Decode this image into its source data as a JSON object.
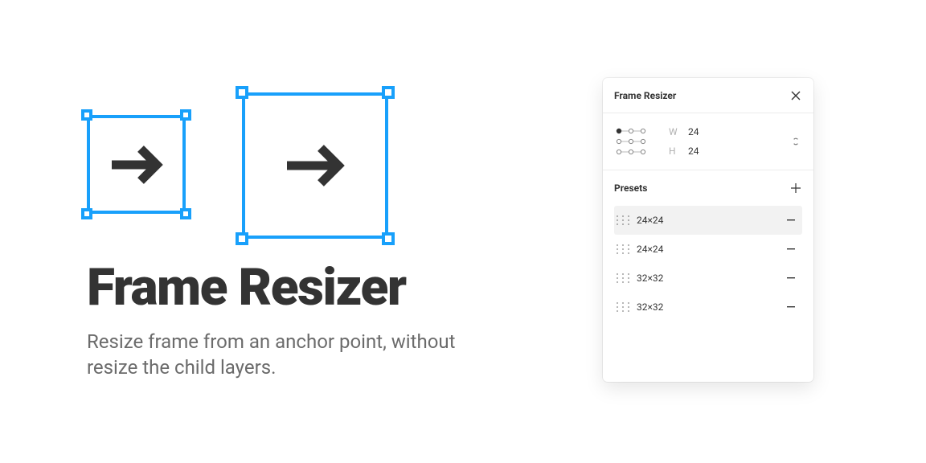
{
  "hero": {
    "title": "Frame Resizer",
    "subtitle": "Resize frame from an anchor point, without resize the child layers."
  },
  "panel": {
    "title": "Frame Resizer",
    "width_label": "W",
    "width_value": "24",
    "height_label": "H",
    "height_value": "24",
    "presets_title": "Presets",
    "presets": [
      {
        "label": "24×24",
        "selected": true
      },
      {
        "label": "24×24",
        "selected": false
      },
      {
        "label": "32×32",
        "selected": false
      },
      {
        "label": "32×32",
        "selected": false
      }
    ]
  },
  "colors": {
    "accent": "#18A0FB",
    "text_dark": "#333333",
    "text_muted": "#6b6b6b"
  }
}
